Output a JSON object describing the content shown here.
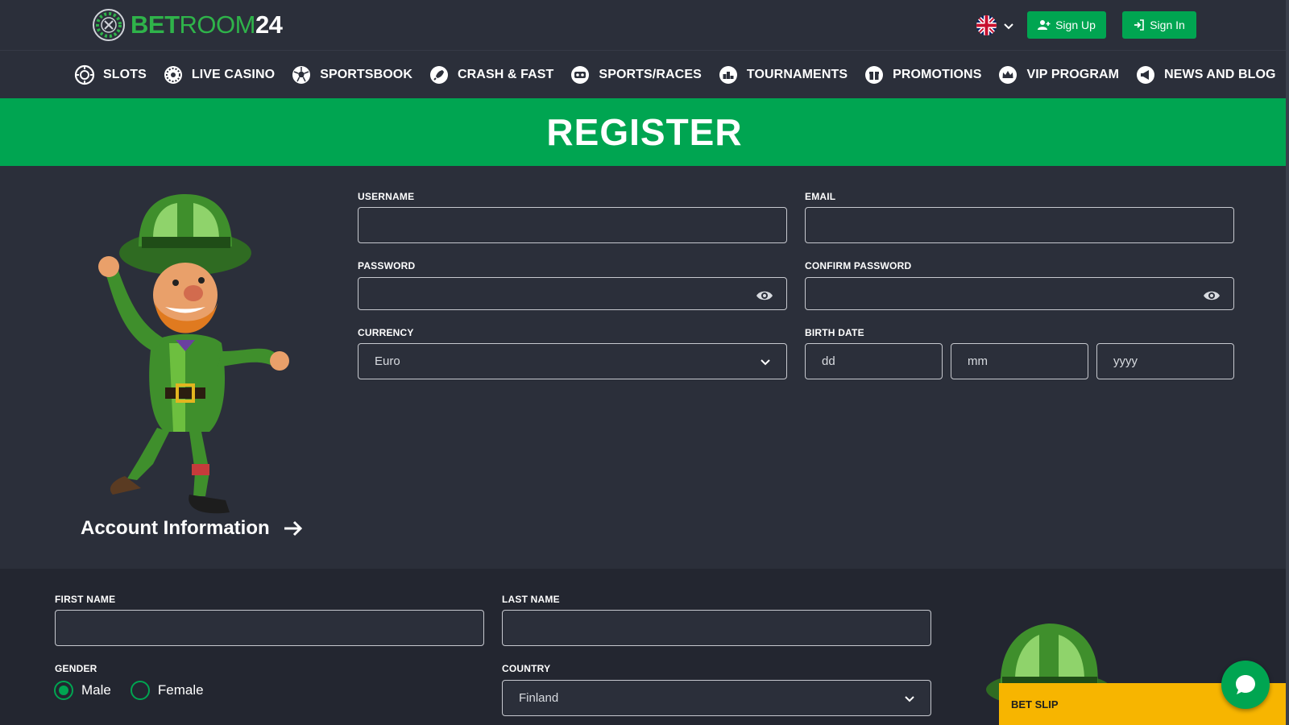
{
  "header": {
    "logo": {
      "part1": "BET",
      "part2": "ROOM",
      "part3": "24"
    },
    "language_flag": "uk-flag-icon",
    "sign_up_label": "Sign Up",
    "sign_in_label": "Sign In"
  },
  "nav": {
    "items": [
      {
        "label": "SLOTS",
        "icon": "slots-icon"
      },
      {
        "label": "LIVE CASINO",
        "icon": "roulette-icon"
      },
      {
        "label": "SPORTSBOOK",
        "icon": "soccer-ball-icon"
      },
      {
        "label": "CRASH & FAST",
        "icon": "rocket-icon"
      },
      {
        "label": "SPORTS/RACES",
        "icon": "vr-headset-icon"
      },
      {
        "label": "TOURNAMENTS",
        "icon": "podium-icon"
      },
      {
        "label": "PROMOTIONS",
        "icon": "gift-icon"
      },
      {
        "label": "VIP PROGRAM",
        "icon": "crown-icon"
      },
      {
        "label": "NEWS AND BLOG",
        "icon": "megaphone-icon"
      }
    ]
  },
  "banner": {
    "title": "REGISTER"
  },
  "account": {
    "section_title": "Account Information",
    "username": {
      "label": "USERNAME",
      "value": ""
    },
    "email": {
      "label": "EMAIL",
      "value": ""
    },
    "password": {
      "label": "PASSWORD",
      "value": ""
    },
    "confirm_password": {
      "label": "CONFIRM PASSWORD",
      "value": ""
    },
    "currency": {
      "label": "CURRENCY",
      "value": "Euro"
    },
    "birth_date": {
      "label": "BIRTH DATE",
      "day_placeholder": "dd",
      "month_placeholder": "mm",
      "year_placeholder": "yyyy"
    }
  },
  "personal": {
    "first_name": {
      "label": "FIRST NAME",
      "value": ""
    },
    "last_name": {
      "label": "LAST NAME",
      "value": ""
    },
    "gender": {
      "label": "GENDER",
      "options": [
        "Male",
        "Female"
      ],
      "selected": "Male"
    },
    "country": {
      "label": "COUNTRY",
      "value": "Finland"
    }
  },
  "betslip": {
    "label": "BET SLIP"
  },
  "colors": {
    "accent": "#00a551",
    "background": "#2b2f3a",
    "panel": "#232630",
    "betslip": "#f7b500"
  }
}
